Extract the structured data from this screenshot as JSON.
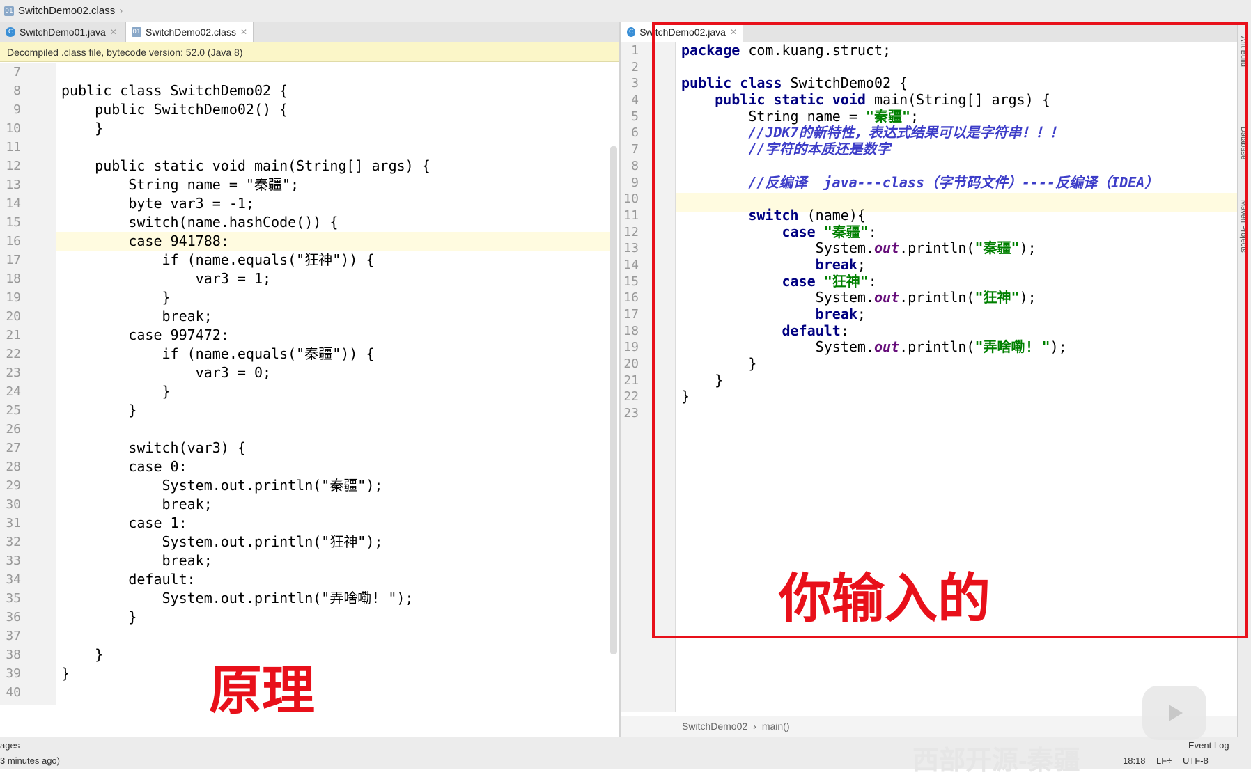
{
  "breadcrumb": {
    "file": "SwitchDemo02.class"
  },
  "left_tabs": [
    {
      "label": "SwitchDemo01.java",
      "icon": "java-class-icon"
    },
    {
      "label": "SwitchDemo02.class",
      "icon": "class-file-icon"
    }
  ],
  "right_tabs": [
    {
      "label": "SwitchDemo02.java",
      "icon": "java-class-icon"
    }
  ],
  "banner": "Decompiled .class file, bytecode version: 52.0 (Java 8)",
  "left_editor": {
    "line_numbers": [
      "7",
      "8",
      "9",
      "10",
      "11",
      "12",
      "13",
      "14",
      "15",
      "16",
      "17",
      "18",
      "19",
      "20",
      "21",
      "22",
      "23",
      "24",
      "25",
      "26",
      "27",
      "28",
      "29",
      "30",
      "31",
      "32",
      "33",
      "34",
      "35",
      "36",
      "37",
      "38",
      "39",
      "40"
    ],
    "lines": [
      "",
      "public class SwitchDemo02 {",
      "    public SwitchDemo02() {",
      "    }",
      "",
      "    public static void main(String[] args) {",
      "        String name = \"秦疆\";",
      "        byte var3 = -1;",
      "        switch(name.hashCode()) {",
      "        case 941788:",
      "            if (name.equals(\"狂神\")) {",
      "                var3 = 1;",
      "            }",
      "            break;",
      "        case 997472:",
      "            if (name.equals(\"秦疆\")) {",
      "                var3 = 0;",
      "            }",
      "        }",
      "",
      "        switch(var3) {",
      "        case 0:",
      "            System.out.println(\"秦疆\");",
      "            break;",
      "        case 1:",
      "            System.out.println(\"狂神\");",
      "            break;",
      "        default:",
      "            System.out.println(\"弄啥嘞! \");",
      "        }",
      "",
      "    }",
      "}",
      ""
    ]
  },
  "right_editor": {
    "line_numbers": [
      "1",
      "2",
      "3",
      "4",
      "5",
      "6",
      "7",
      "8",
      "9",
      "10",
      "11",
      "12",
      "13",
      "14",
      "15",
      "16",
      "17",
      "18",
      "19",
      "20",
      "21",
      "22",
      "23"
    ],
    "lines": [
      [
        {
          "t": "package ",
          "c": "kw"
        },
        {
          "t": "com.kuang.struct;",
          "c": ""
        }
      ],
      [],
      [
        {
          "t": "public class ",
          "c": "kw"
        },
        {
          "t": "SwitchDemo02 {",
          "c": ""
        }
      ],
      [
        {
          "t": "    public static void ",
          "c": "kw"
        },
        {
          "t": "main(String[] args) {",
          "c": ""
        }
      ],
      [
        {
          "t": "        String name = ",
          "c": ""
        },
        {
          "t": "\"秦疆\"",
          "c": "str"
        },
        {
          "t": ";",
          "c": ""
        }
      ],
      [
        {
          "t": "        //JDK7的新特性，表达式结果可以是字符串！！！",
          "c": "cmt"
        }
      ],
      [
        {
          "t": "        //字符的本质还是数字",
          "c": "cmt"
        }
      ],
      [],
      [
        {
          "t": "        //反编译  java---class（字节码文件）----反编译（IDEA）",
          "c": "cmt"
        }
      ],
      [],
      [
        {
          "t": "        switch ",
          "c": "kw"
        },
        {
          "t": "(name){",
          "c": ""
        }
      ],
      [
        {
          "t": "            case ",
          "c": "kw"
        },
        {
          "t": "\"秦疆\"",
          "c": "str"
        },
        {
          "t": ":",
          "c": ""
        }
      ],
      [
        {
          "t": "                System.",
          "c": ""
        },
        {
          "t": "out",
          "c": "fld"
        },
        {
          "t": ".println(",
          "c": ""
        },
        {
          "t": "\"秦疆\"",
          "c": "str"
        },
        {
          "t": ");",
          "c": ""
        }
      ],
      [
        {
          "t": "                break",
          "c": "kw"
        },
        {
          "t": ";",
          "c": ""
        }
      ],
      [
        {
          "t": "            case ",
          "c": "kw"
        },
        {
          "t": "\"狂神\"",
          "c": "str"
        },
        {
          "t": ":",
          "c": ""
        }
      ],
      [
        {
          "t": "                System.",
          "c": ""
        },
        {
          "t": "out",
          "c": "fld"
        },
        {
          "t": ".println(",
          "c": ""
        },
        {
          "t": "\"狂神\"",
          "c": "str"
        },
        {
          "t": ");",
          "c": ""
        }
      ],
      [
        {
          "t": "                break",
          "c": "kw"
        },
        {
          "t": ";",
          "c": ""
        }
      ],
      [
        {
          "t": "            default",
          "c": "kw"
        },
        {
          "t": ":",
          "c": ""
        }
      ],
      [
        {
          "t": "                System.",
          "c": ""
        },
        {
          "t": "out",
          "c": "fld"
        },
        {
          "t": ".println(",
          "c": ""
        },
        {
          "t": "\"弄啥嘞! \"",
          "c": "str"
        },
        {
          "t": ");",
          "c": ""
        }
      ],
      [
        {
          "t": "        }",
          "c": ""
        }
      ],
      [
        {
          "t": "    }",
          "c": ""
        }
      ],
      [
        {
          "t": "}",
          "c": ""
        }
      ],
      []
    ]
  },
  "right_breadcrumb": {
    "class": "SwitchDemo02",
    "method": "main()"
  },
  "captions": {
    "left": "原理",
    "right": "你输入的"
  },
  "side_tools": [
    "Ant Build",
    "Database",
    "Maven Projects"
  ],
  "status": {
    "left_top": "ages",
    "left_bottom": "3 minutes ago)",
    "event_log": "Event Log",
    "position": "18:18",
    "line_sep": "LF÷",
    "encoding": "UTF-8",
    "watermark": "西部开源-秦疆"
  },
  "colors": {
    "annotation_red": "#e8101a",
    "keyword": "#000080",
    "string": "#008000",
    "comment": "#3d3dc8"
  }
}
